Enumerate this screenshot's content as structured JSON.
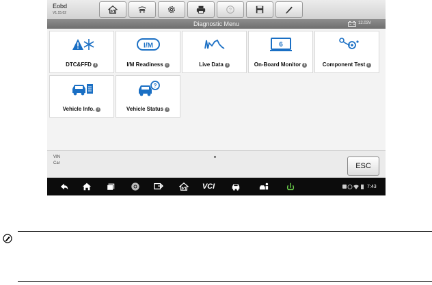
{
  "app": {
    "title": "Eobd",
    "version": "V1.15.02"
  },
  "toolbar": {
    "buttons": [
      {
        "icon": "home-icon"
      },
      {
        "icon": "vehicle-swap-icon"
      },
      {
        "icon": "gear-icon"
      },
      {
        "icon": "printer-icon"
      },
      {
        "icon": "help-icon"
      },
      {
        "icon": "save-icon"
      },
      {
        "icon": "pen-icon"
      }
    ]
  },
  "menu": {
    "title": "Diagnostic Menu",
    "battery_voltage": "12.03V"
  },
  "functions": [
    {
      "label": "DTC&FFD",
      "icon": "dtc-ffd-icon"
    },
    {
      "label": "I/M Readiness",
      "icon": "im-readiness-icon"
    },
    {
      "label": "Live Data",
      "icon": "live-data-icon"
    },
    {
      "label": "On-Board Monitor",
      "icon": "on-board-monitor-icon"
    },
    {
      "label": "Component Test",
      "icon": "component-test-icon"
    },
    {
      "label": "Vehicle Info.",
      "icon": "vehicle-info-icon"
    },
    {
      "label": "Vehicle Status",
      "icon": "vehicle-status-icon"
    }
  ],
  "footer": {
    "vin_label": "VIN",
    "car_label": "Car",
    "esc_label": "ESC"
  },
  "navbar": {
    "icons": [
      "back-icon",
      "home-icon",
      "recent-apps-icon",
      "chrome-icon",
      "screen-share-icon",
      "maxisys-home-icon",
      "vci-icon",
      "car-icon",
      "car-shop-icon",
      "ecu-icon"
    ],
    "vci_label": "VCI",
    "time": "7:43"
  },
  "colors": {
    "accent_blue": "#1a6fc4",
    "toolbar_grey": "#d2d2d2",
    "menu_bar": "#7a7a7a",
    "navbar": "#0c0c0c"
  }
}
